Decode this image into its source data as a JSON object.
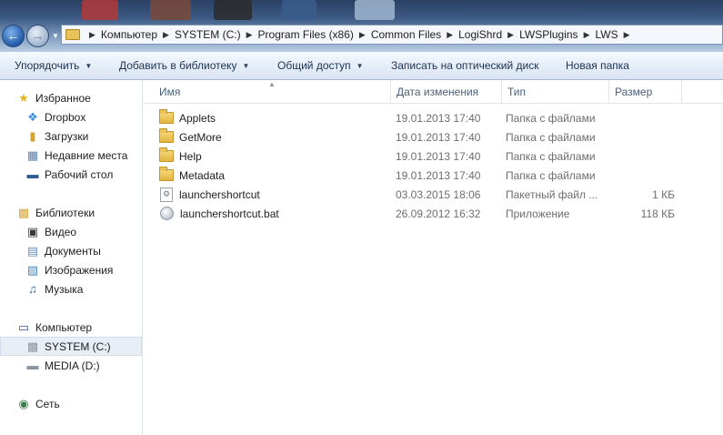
{
  "address": {
    "crumbs": [
      "Компьютер",
      "SYSTEM (C:)",
      "Program Files (x86)",
      "Common Files",
      "LogiShrd",
      "LWSPlugins",
      "LWS"
    ]
  },
  "toolbar": {
    "organize": "Упорядочить",
    "add_to_library": "Добавить в библиотеку",
    "share": "Общий доступ",
    "burn": "Записать на оптический диск",
    "new_folder": "Новая папка"
  },
  "sidebar": {
    "favorites": {
      "header": "Избранное",
      "items": [
        "Dropbox",
        "Загрузки",
        "Недавние места",
        "Рабочий стол"
      ]
    },
    "libraries": {
      "header": "Библиотеки",
      "items": [
        "Видео",
        "Документы",
        "Изображения",
        "Музыка"
      ]
    },
    "computer": {
      "header": "Компьютер",
      "items": [
        "SYSTEM (C:)",
        "MEDIA (D:)"
      ]
    },
    "network": {
      "header": "Сеть"
    }
  },
  "columns": {
    "name": "Имя",
    "date": "Дата изменения",
    "type": "Тип",
    "size": "Размер"
  },
  "files": [
    {
      "name": "Applets",
      "date": "19.01.2013 17:40",
      "type": "Папка с файлами",
      "size": "",
      "icon": "folder-icon"
    },
    {
      "name": "GetMore",
      "date": "19.01.2013 17:40",
      "type": "Папка с файлами",
      "size": "",
      "icon": "folder-icon"
    },
    {
      "name": "Help",
      "date": "19.01.2013 17:40",
      "type": "Папка с файлами",
      "size": "",
      "icon": "folder-icon"
    },
    {
      "name": "Metadata",
      "date": "19.01.2013 17:40",
      "type": "Папка с файлами",
      "size": "",
      "icon": "folder-icon"
    },
    {
      "name": "launchershortcut",
      "date": "03.03.2015 18:06",
      "type": "Пакетный файл ...",
      "size": "1 КБ",
      "icon": "batch-file-icon"
    },
    {
      "name": "launchershortcut.bat",
      "date": "26.09.2012 16:32",
      "type": "Приложение",
      "size": "118 КБ",
      "icon": "application-icon"
    }
  ]
}
